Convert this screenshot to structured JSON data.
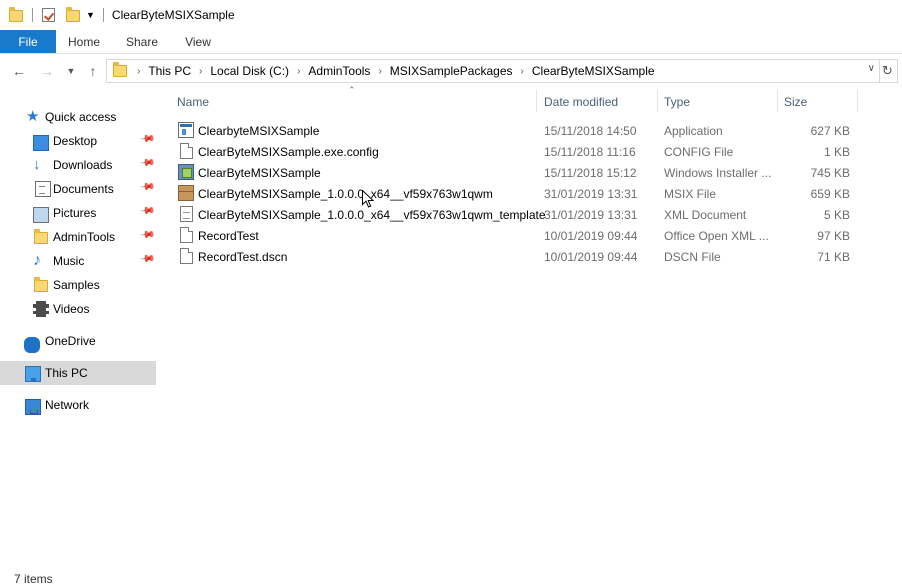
{
  "window": {
    "title": "ClearByteMSIXSample"
  },
  "ribbon": {
    "tabs": [
      "File",
      "Home",
      "Share",
      "View"
    ]
  },
  "address": {
    "crumbs": [
      "This PC",
      "Local Disk (C:)",
      "AdminTools",
      "MSIXSamplePackages",
      "ClearByteMSIXSample"
    ]
  },
  "navigation": {
    "quick_access": "Quick access",
    "items": [
      "Desktop",
      "Downloads",
      "Documents",
      "Pictures",
      "AdminTools",
      "Music",
      "Samples",
      "Videos"
    ],
    "onedrive": "OneDrive",
    "this_pc": "This PC",
    "network": "Network"
  },
  "columns": {
    "name": "Name",
    "date": "Date modified",
    "type": "Type",
    "size": "Size"
  },
  "files": [
    {
      "name": "ClearbyteMSIXSample",
      "date": "15/11/2018 14:50",
      "type": "Application",
      "size": "627 KB",
      "icon": "application-icon"
    },
    {
      "name": "ClearByteMSIXSample.exe.config",
      "date": "15/11/2018 11:16",
      "type": "CONFIG File",
      "size": "1 KB",
      "icon": "config-file-icon"
    },
    {
      "name": "ClearByteMSIXSample",
      "date": "15/11/2018 15:12",
      "type": "Windows Installer ...",
      "size": "745 KB",
      "icon": "msi-installer-icon"
    },
    {
      "name": "ClearByteMSIXSample_1.0.0.0_x64__vf59x763w1qwm",
      "date": "31/01/2019 13:31",
      "type": "MSIX File",
      "size": "659 KB",
      "icon": "package-box-icon"
    },
    {
      "name": "ClearByteMSIXSample_1.0.0.0_x64__vf59x763w1qwm_template",
      "date": "31/01/2019 13:31",
      "type": "XML Document",
      "size": "5 KB",
      "icon": "xml-document-icon"
    },
    {
      "name": "RecordTest",
      "date": "10/01/2019 09:44",
      "type": "Office Open XML ...",
      "size": "97 KB",
      "icon": "document-icon"
    },
    {
      "name": "RecordTest.dscn",
      "date": "10/01/2019 09:44",
      "type": "DSCN File",
      "size": "71 KB",
      "icon": "document-icon"
    }
  ],
  "status": {
    "item_count": "7 items"
  },
  "colors": {
    "file_tab": "#1979ca",
    "selected_nav": "#d9d9d9",
    "header_text": "#4c607a"
  }
}
